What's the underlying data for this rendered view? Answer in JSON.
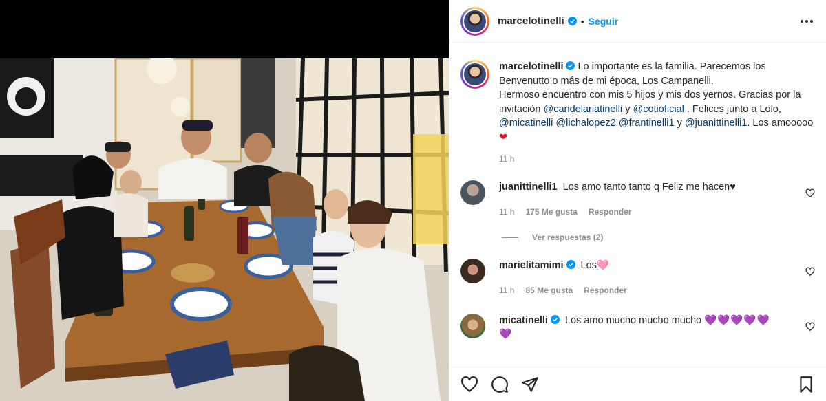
{
  "post": {
    "author": "marcelotinelli",
    "follow_label": "Seguir",
    "separator": "•"
  },
  "caption": {
    "user": "marcelotinelli",
    "line1": "Lo importante es la familia. Parecemos los Benvenutto o más de mi época, Los Campanelli.",
    "line2": "Hermoso encuentro con mis 5 hijos y mis dos yernos. Gracias por la invitación",
    "mention_a": "@candelariatinelli",
    "y1": "y",
    "mention_b": "@cotioficial",
    "line3": ". Felices junto a Lolo,",
    "mention_c": "@micatinelli",
    "mention_d": "@lichalopez2",
    "mention_e": "@frantinelli1",
    "y2": "y",
    "mention_f": "@juanittinelli1",
    "line4": ". Los amooooo",
    "heart": "❤",
    "time": "11 h"
  },
  "comments": [
    {
      "user": "juanittinelli1",
      "text": "Los amo tanto tanto q Feliz me hacen♥",
      "time": "11 h",
      "likes": "175 Me gusta",
      "reply": "Responder",
      "avatar_color": "#4a5560"
    },
    {
      "user": "marielitamimi",
      "text": "Los🩷",
      "time": "11 h",
      "likes": "85 Me gusta",
      "reply": "Responder",
      "avatar_color": "#3b2a22"
    },
    {
      "user": "micatinelli",
      "text": "Los amo mucho mucho mucho",
      "hearts": "💜💜💜💜💜",
      "heart_extra": "💜",
      "avatar_color": "#8b6a3e"
    }
  ],
  "view_replies": "Ver respuestas (2)",
  "icons": {
    "like": "heart-icon",
    "comment": "comment-icon",
    "share": "share-icon",
    "save": "bookmark-icon",
    "more": "more-icon",
    "verified": "verified-icon"
  },
  "colors": {
    "accent": "#0095f6",
    "verified": "#0095f6",
    "mention": "#00376b",
    "secondary_text": "#8e8e8e"
  }
}
